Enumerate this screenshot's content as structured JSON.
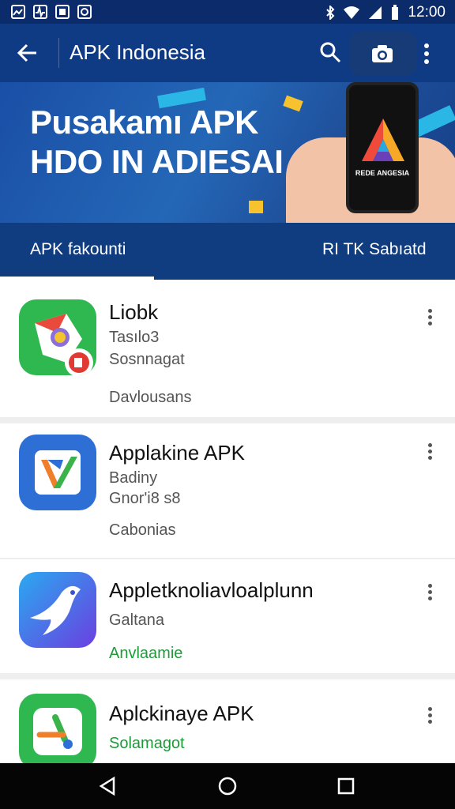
{
  "status_bar": {
    "time": "12:00",
    "left_icons": [
      "image-icon",
      "activity-icon",
      "file-icon",
      "gallery-icon"
    ],
    "right_icons": [
      "bluetooth-icon",
      "wifi-icon",
      "signal-icon",
      "battery-icon"
    ]
  },
  "app_bar": {
    "title": "APK Indonesia",
    "icons": [
      "back-arrow-icon",
      "search-icon",
      "camera-icon",
      "more-vert-icon"
    ]
  },
  "banner": {
    "line1": "Pusakamı APK",
    "line2": "HDO IN ADIESAI",
    "phone_caption": "REDE ANGESIA"
  },
  "tabs": [
    {
      "label": "APK fakounti",
      "selected": true
    },
    {
      "label": "RI TK Sabıatd",
      "selected": false
    }
  ],
  "apps": [
    {
      "name": "Liobk",
      "line1": "Tasılo3",
      "line2": "Sosnnagat",
      "line3": "Davlousans",
      "icon": "chrome-style-icon"
    },
    {
      "name": "Applakine APK",
      "line1": "Badiny",
      "line2": "Gnor'i8 s8",
      "line3": "Cabonias",
      "icon": "check-shield-icon"
    },
    {
      "name": "Appletknoliavloalplunn",
      "line1": "Galtana",
      "line2": "Anvlaamie",
      "icon": "bird-icon"
    },
    {
      "name": "Aplckinaye APK",
      "line1": "Solamagot",
      "icon": "green-pencil-icon"
    }
  ],
  "nav_bar": {
    "icons": [
      "back-triangle-icon",
      "home-circle-icon",
      "recents-square-icon"
    ]
  },
  "colors": {
    "status_bar": "#0b2b6b",
    "app_bar": "#0f3a84",
    "accent_green": "#1e9a3a"
  }
}
